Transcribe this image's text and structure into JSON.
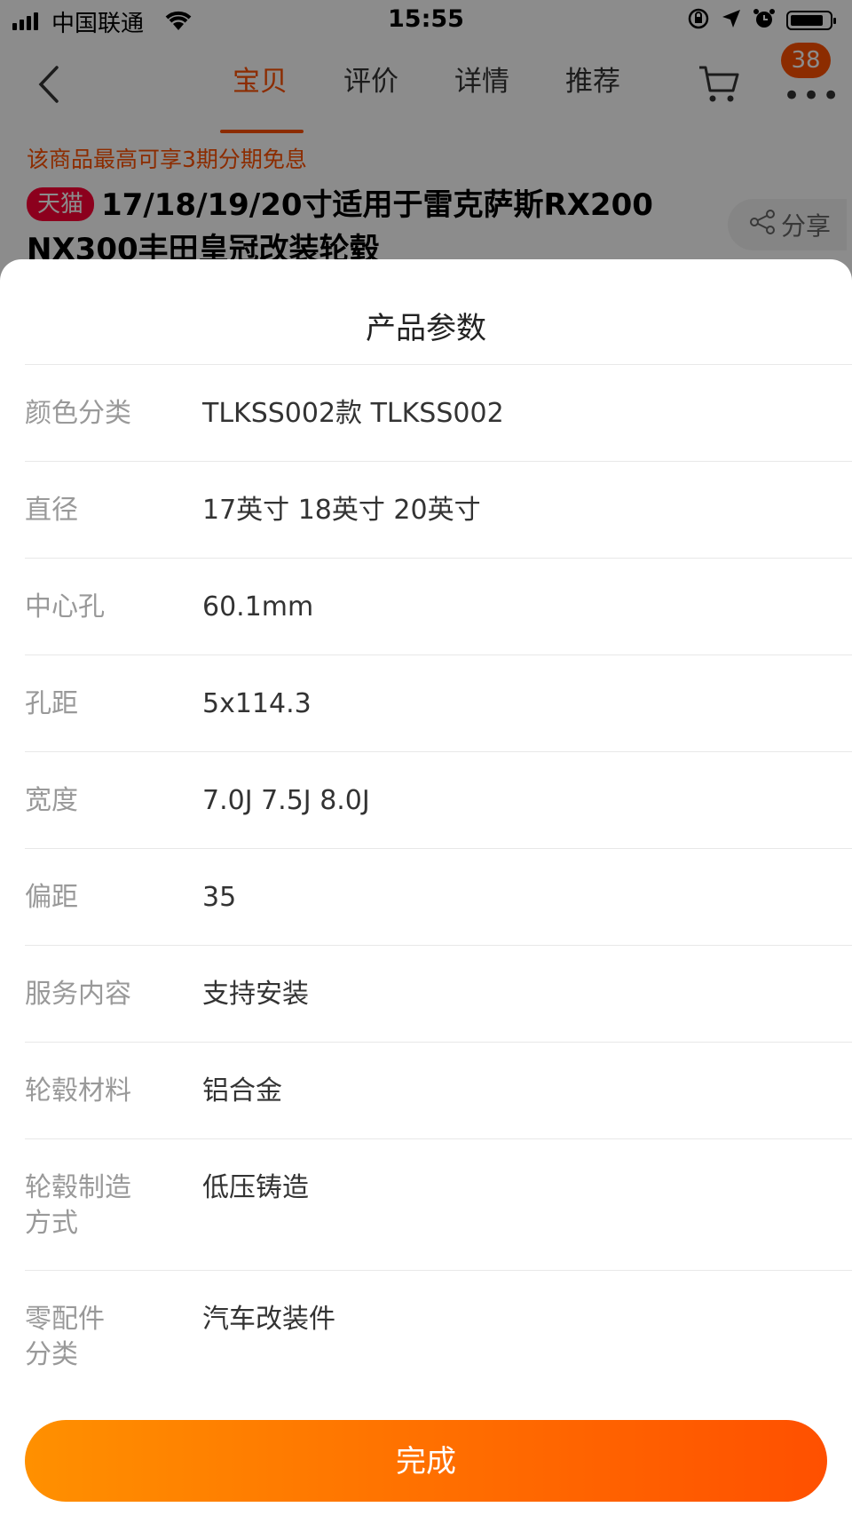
{
  "status_bar": {
    "carrier": "中国联通",
    "time": "15:55"
  },
  "nav": {
    "tabs": [
      {
        "label": "宝贝",
        "active": true
      },
      {
        "label": "评价",
        "active": false
      },
      {
        "label": "详情",
        "active": false
      },
      {
        "label": "推荐",
        "active": false
      }
    ],
    "badge_count": "38",
    "accent_color": "#ff5000"
  },
  "product": {
    "promo_text": "该商品最高可享3期分期免息",
    "store_tag": "天猫",
    "title": "17/18/19/20寸适用于雷克萨斯RX200 NX300丰田皇冠改装轮毂",
    "share_label": "分享"
  },
  "sheet": {
    "title": "产品参数",
    "params": [
      {
        "label": "颜色分类",
        "value": "TLKSS002款 TLKSS002"
      },
      {
        "label": "直径",
        "value": "17英寸 18英寸 20英寸"
      },
      {
        "label": "中心孔",
        "value": "60.1mm"
      },
      {
        "label": "孔距",
        "value": "5x114.3"
      },
      {
        "label": "宽度",
        "value": "7.0J 7.5J 8.0J"
      },
      {
        "label": "偏距",
        "value": "35"
      },
      {
        "label": "服务内容",
        "value": "支持安装"
      },
      {
        "label": "轮毂材料",
        "value": "铝合金"
      },
      {
        "label": "轮毂制造方式",
        "value": "低压铸造"
      },
      {
        "label": "零配件分类",
        "value": "汽车改装件"
      }
    ],
    "done_label": "完成"
  }
}
